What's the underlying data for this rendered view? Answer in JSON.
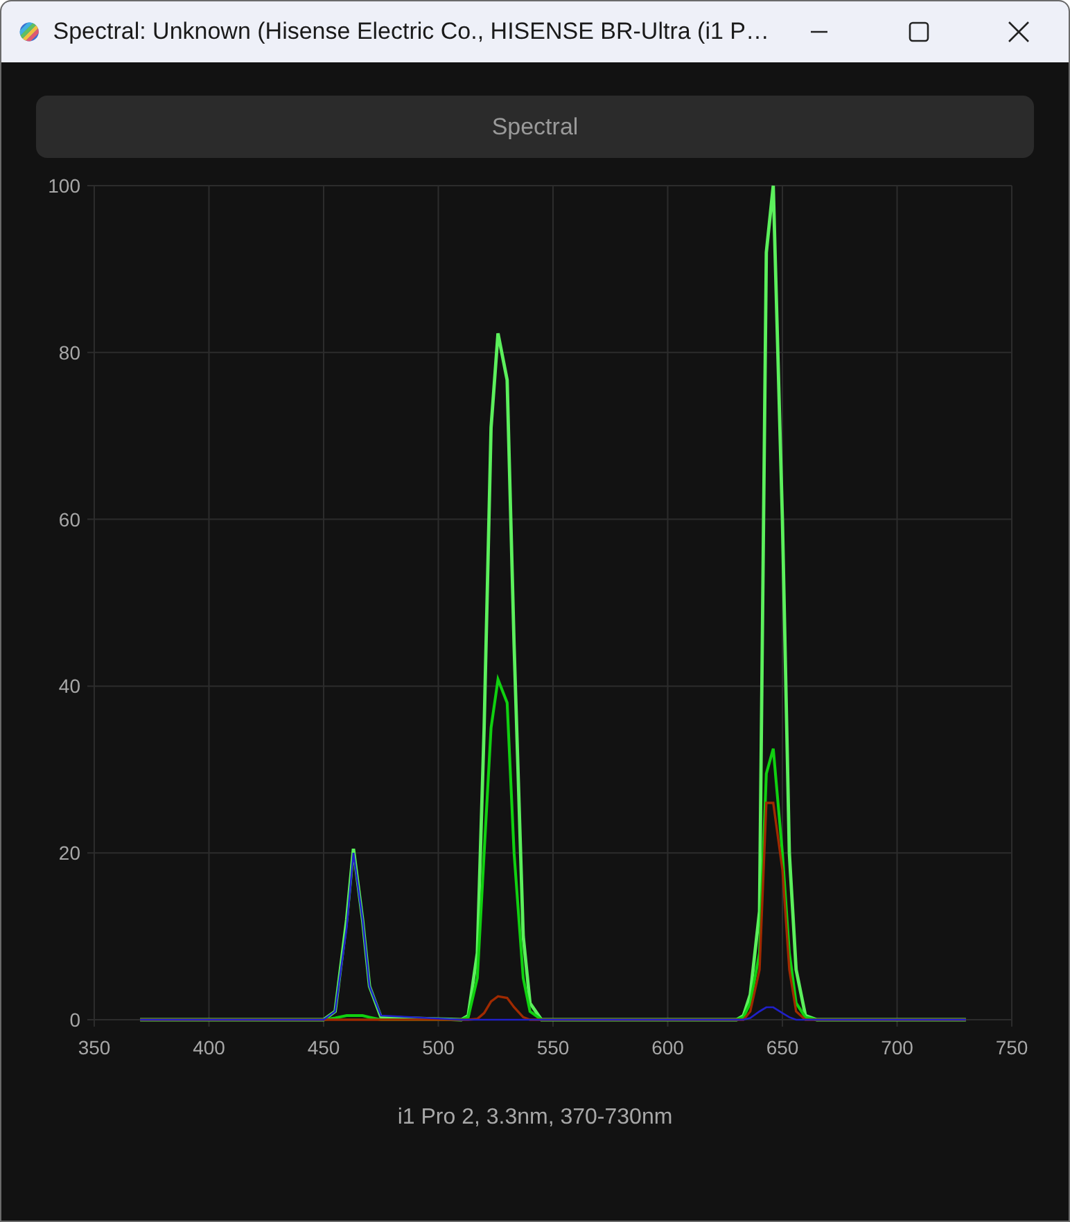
{
  "window": {
    "title": "Spectral: Unknown (Hisense Electric Co., HISENSE BR-Ultra (i1 P…"
  },
  "mode_button": {
    "label": "Spectral"
  },
  "chart": {
    "chart_data": {
      "type": "line",
      "x": [
        370,
        450,
        455,
        460,
        463,
        467,
        470,
        475,
        510,
        513,
        517,
        520,
        523,
        526,
        530,
        533,
        537,
        540,
        545,
        630,
        633,
        636,
        640,
        643,
        646,
        650,
        653,
        656,
        660,
        665,
        730
      ],
      "series": [
        {
          "color": "#5cf05c",
          "values": [
            0,
            0,
            1,
            12,
            20.5,
            12,
            4,
            0.3,
            0,
            0.5,
            8,
            35,
            71,
            82.3,
            76.7,
            45,
            10,
            2,
            0,
            0,
            0.5,
            3,
            13,
            92,
            100,
            60,
            20,
            6,
            0.5,
            0,
            0
          ]
        },
        {
          "color": "#10d010",
          "values": [
            0,
            0,
            0.2,
            0.5,
            0.5,
            0.5,
            0.3,
            0,
            0,
            0.3,
            5,
            20,
            35,
            40.8,
            38,
            20,
            5,
            1,
            0,
            0,
            0.3,
            2,
            8,
            29.5,
            32.5,
            20,
            8,
            2,
            0.3,
            0,
            0
          ]
        },
        {
          "color": "#a02a00",
          "values": [
            0,
            0,
            0,
            0,
            0,
            0,
            0,
            0,
            0,
            0,
            0.1,
            0.8,
            2.2,
            2.8,
            2.6,
            1.5,
            0.3,
            0,
            0,
            0,
            0,
            1,
            6,
            26,
            26,
            18,
            6,
            1,
            0,
            0,
            0
          ]
        },
        {
          "color": "#2020c8",
          "values": [
            0,
            0,
            1,
            11,
            20,
            12,
            4,
            0.5,
            0,
            0,
            0,
            0,
            0,
            0,
            0,
            0,
            0,
            0,
            0,
            0,
            0,
            0.2,
            1,
            1.5,
            1.5,
            0.8,
            0.3,
            0,
            0,
            0,
            0
          ]
        }
      ],
      "grid": true,
      "xlim": [
        350,
        750
      ],
      "ylim": [
        0,
        100
      ],
      "xticks": [
        350,
        400,
        450,
        500,
        550,
        600,
        650,
        700,
        750
      ],
      "yticks": [
        0,
        20,
        40,
        60,
        80,
        100
      ]
    }
  },
  "footer": {
    "text": "i1 Pro 2, 3.3nm, 370-730nm"
  }
}
